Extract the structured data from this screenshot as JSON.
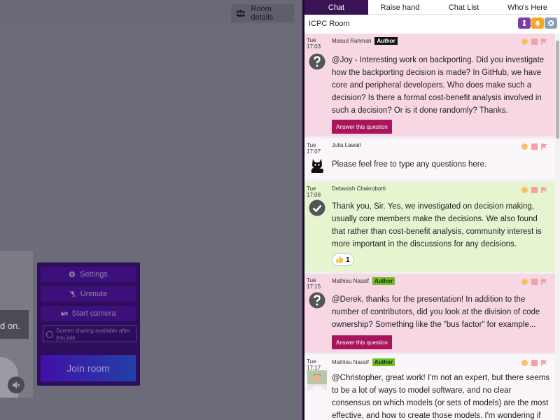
{
  "left": {
    "room_details_label": "Room details",
    "video_text": "d on.",
    "join_panel": {
      "settings_label": "Settings",
      "unmute_label": "Unmute",
      "start_camera_label": "Start camera",
      "screen_share_note": "Screen sharing available after you join",
      "join_label": "Join room"
    }
  },
  "tabs": [
    "Chat",
    "Raise hand",
    "Chat List",
    "Who's Here"
  ],
  "room_name": "ICPC Room",
  "messages": [
    {
      "day": "Tue",
      "time": "17:03",
      "author": "Masud Rahman",
      "badge": "Author",
      "text": "@Joy - Interesting work on backporting. Did you investigate how the backporting decision is made? In GitHub, we have core and peripheral developers. Who does make such a decision? Is there a formal cost-benefit analysis involved in such a decision? Or is it done randomly? Thanks.",
      "button": "Answer this question",
      "avatar": "question-icon"
    },
    {
      "day": "Tue",
      "time": "17:07",
      "author": "Julia Lawall",
      "text": "Please feel free to type any questions here.",
      "avatar": "cat-icon"
    },
    {
      "day": "Tue",
      "time": "17:08",
      "author": "Debasish Chakroborti",
      "text": "Thank you, Sir. Yes, we investigated on decision making, usually core members make the decisions. We also found that rather than cost-benefit analysis, community interest is more important in the discussions for any decisions.",
      "reaction_count": "1",
      "avatar": "check-icon"
    },
    {
      "day": "Tue",
      "time": "17:15",
      "author": "Mathieu Nassif",
      "badge": "Author",
      "text": "@Derek, thanks for the presentation! In addition to the number of contributors, did you look at the division of code ownership? Something like the \"bus factor\" for example...",
      "button": "Answer this question",
      "avatar": "question-icon"
    },
    {
      "day": "Tue",
      "time": "17:17",
      "author": "Mathieu Nassif",
      "badge": "Author",
      "text": "@Christopher, great work! I'm not an expert, but there seems to be a lot of ways to model software, and no clear consensus on which models (or sets of models) are the most effective, and how to create those models. I'm wondering if we're really",
      "avatar": "user-photo"
    }
  ],
  "colors": {
    "question_bg": "#f7d7e3",
    "normal_bg": "#fbf6fa",
    "answered_bg": "#e6f5d0",
    "answer_button": "#a8155c",
    "active_tab": "#3a1354",
    "author_badge_green": "#6cc023"
  }
}
